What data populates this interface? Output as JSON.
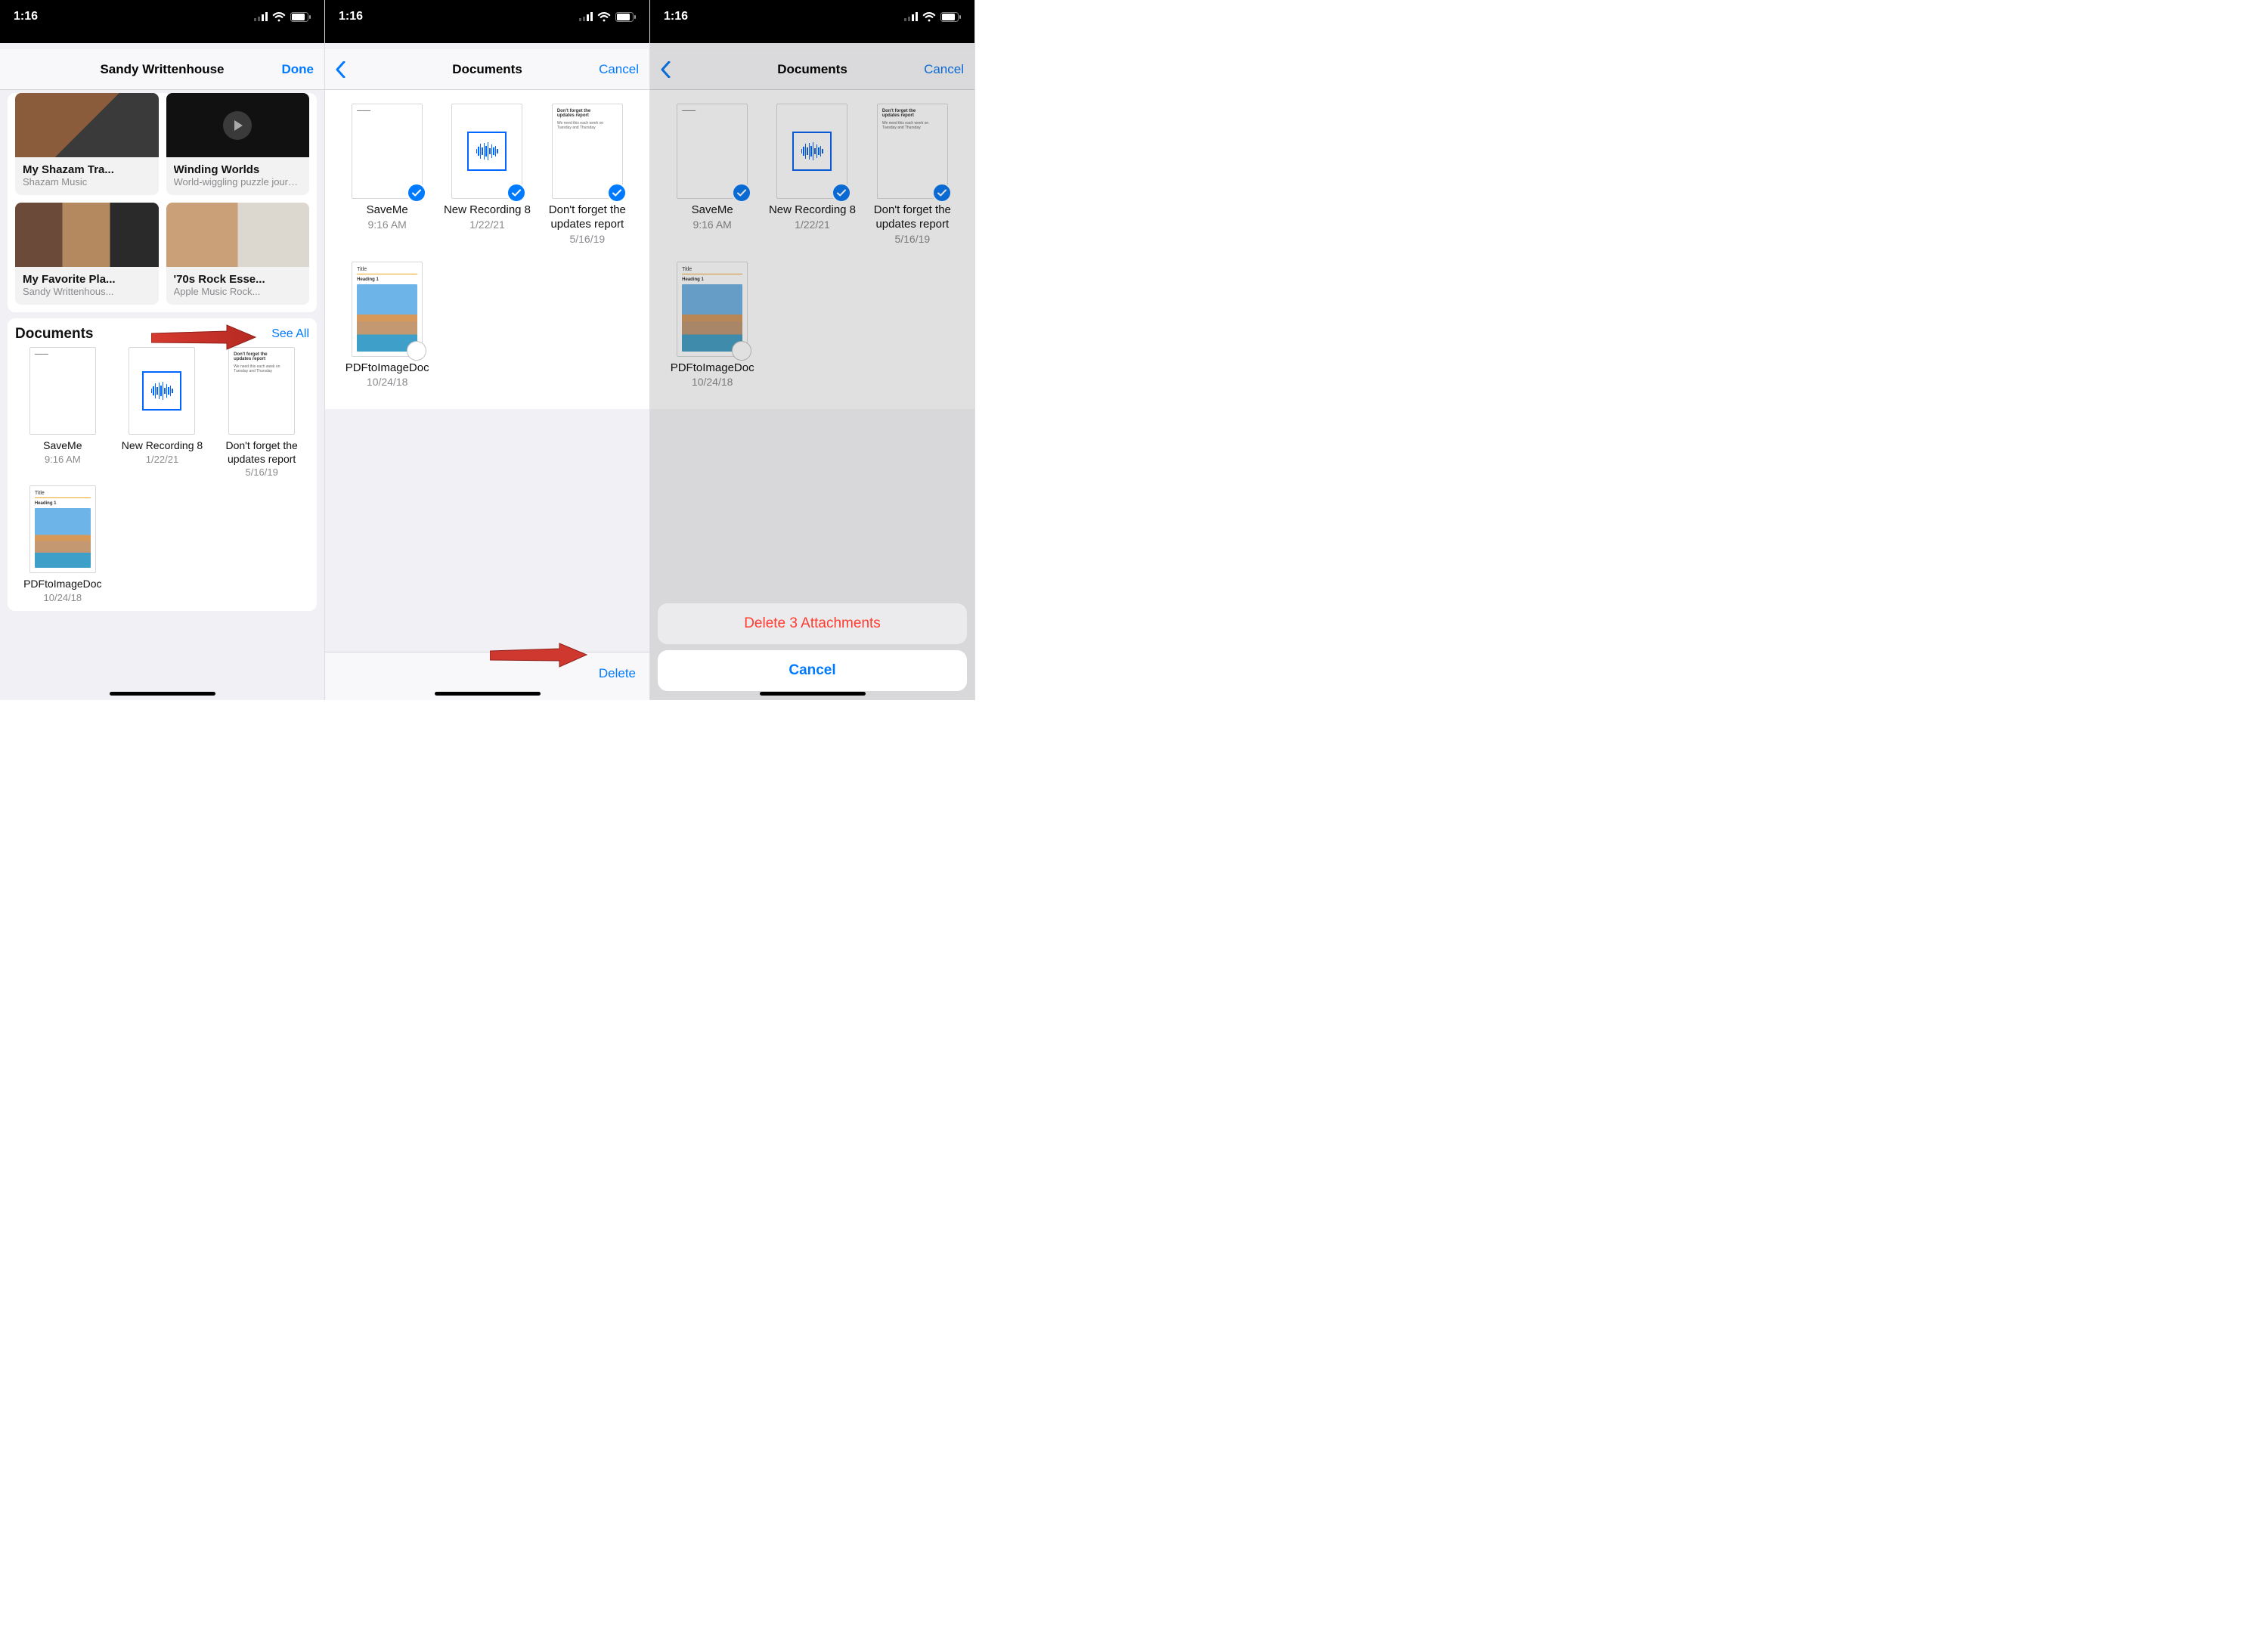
{
  "status": {
    "time": "1:16"
  },
  "phone1": {
    "nav": {
      "title": "Sandy Writtenhouse",
      "done": "Done"
    },
    "playlists": [
      {
        "title": "My Shazam Tra...",
        "sub": "Shazam Music"
      },
      {
        "title": "Winding Worlds",
        "sub": "World-wiggling puzzle journey"
      },
      {
        "title": "My Favorite Pla...",
        "sub": "Sandy Writtenhous..."
      },
      {
        "title": "'70s Rock Esse...",
        "sub": "Apple Music Rock..."
      }
    ],
    "documents": {
      "heading": "Documents",
      "see_all": "See All",
      "items": [
        {
          "name": "SaveMe",
          "date": "9:16 AM"
        },
        {
          "name": "New Recording 8",
          "date": "1/22/21"
        },
        {
          "name": "Don't forget the updates report",
          "date": "5/16/19"
        },
        {
          "name": "PDFtoImageDoc",
          "date": "10/24/18"
        }
      ]
    }
  },
  "phone2": {
    "nav": {
      "title": "Documents",
      "cancel": "Cancel"
    },
    "items": [
      {
        "name": "SaveMe",
        "date": "9:16 AM",
        "selected": true
      },
      {
        "name": "New Recording 8",
        "date": "1/22/21",
        "selected": true
      },
      {
        "name": "Don't forget the updates report",
        "date": "5/16/19",
        "selected": true
      },
      {
        "name": "PDFtoImageDoc",
        "date": "10/24/18",
        "selected": false
      }
    ],
    "delete": "Delete"
  },
  "phone3": {
    "nav": {
      "title": "Documents",
      "cancel": "Cancel"
    },
    "items": [
      {
        "name": "SaveMe",
        "date": "9:16 AM",
        "selected": true
      },
      {
        "name": "New Recording 8",
        "date": "1/22/21",
        "selected": true
      },
      {
        "name": "Don't forget the updates report",
        "date": "5/16/19",
        "selected": true
      },
      {
        "name": "PDFtoImageDoc",
        "date": "10/24/18",
        "selected": false
      }
    ],
    "sheet": {
      "delete": "Delete 3 Attachments",
      "cancel": "Cancel"
    }
  }
}
